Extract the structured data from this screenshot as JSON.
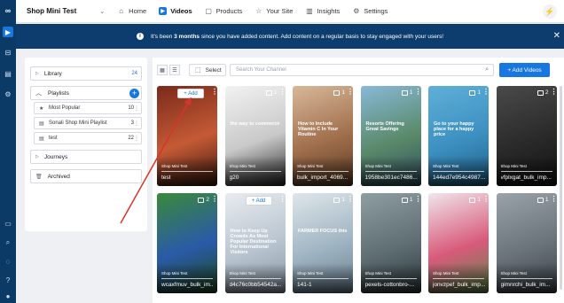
{
  "app": {
    "shop_name": "Shop Mini Test"
  },
  "nav": [
    {
      "label": "Home",
      "icon": "home-icon",
      "glyph": "⌂",
      "active": false
    },
    {
      "label": "Videos",
      "icon": "play-icon",
      "glyph": "▶",
      "active": true
    },
    {
      "label": "Products",
      "icon": "bag-icon",
      "glyph": "▢",
      "active": false
    },
    {
      "label": "Your Site",
      "icon": "star-icon",
      "glyph": "☆",
      "active": false
    },
    {
      "label": "Insights",
      "icon": "chart-icon",
      "glyph": "▥",
      "active": false
    },
    {
      "label": "Settings",
      "icon": "gear-icon",
      "glyph": "⚙",
      "active": false
    }
  ],
  "banner": {
    "prefix": "It's been ",
    "bold": "3 months",
    "suffix": " since you have added content. Add content on a regular basis to stay engaged with your users!"
  },
  "library": {
    "library_label": "Library",
    "library_count": "24",
    "playlists_label": "Playlists",
    "playlists": [
      {
        "name": "Most Popular",
        "count": "10",
        "icon": "star-icon",
        "glyph": "★"
      },
      {
        "name": "Sonali Shop Mini Playlist",
        "count": "3",
        "icon": "list-icon",
        "glyph": "▤"
      },
      {
        "name": "test",
        "count": "22",
        "icon": "list-icon",
        "glyph": "▤"
      }
    ],
    "journeys_label": "Journeys",
    "archived_label": "Archived"
  },
  "toolbar": {
    "select_label": "Select",
    "search_placeholder": "Search Your Channel",
    "add_videos_label": "+ Add Videos",
    "add_label": "+ Add"
  },
  "videos": [
    {
      "title": "test",
      "count": "",
      "brand": "Shop Mini Test",
      "colors": [
        "#7a2a1a",
        "#c55a35",
        "#3b1a10"
      ],
      "add_button": true,
      "overlay": ""
    },
    {
      "title": "g20",
      "count": "1",
      "brand": "Shop Mini Test",
      "colors": [
        "#f2f2f2",
        "#c9c9c9",
        "#2b2b2b"
      ],
      "add_button": false,
      "overlay": "the way to commerce"
    },
    {
      "title": "bulk_import_4069...",
      "count": "1",
      "brand": "Shop Mini Test",
      "colors": [
        "#d8b89a",
        "#a06f4c",
        "#5a3a24"
      ],
      "add_button": false,
      "overlay": "How to Include Vitamin C In Your Routine"
    },
    {
      "title": "1958be301ec7486...",
      "count": "1",
      "brand": "Shop Mini Test",
      "colors": [
        "#88b9d9",
        "#5a8a6a",
        "#2f4f5f"
      ],
      "add_button": false,
      "overlay": "Resorts Offering Great Savings"
    },
    {
      "title": "144ed7e954c4987...",
      "count": "1",
      "brand": "Shop Mini Test",
      "colors": [
        "#5fb0d8",
        "#3c8fc0",
        "#1e5e86"
      ],
      "add_button": false,
      "overlay": "Go to your happy place for a happy price"
    },
    {
      "title": "vfplxgat_bulk_imp...",
      "count": "2",
      "brand": "Shop Mini Test",
      "colors": [
        "#4a4a4a",
        "#2a2a2a",
        "#111111"
      ],
      "add_button": false,
      "overlay": ""
    },
    {
      "title": "wcaxfmuv_bulk_im...",
      "count": "2",
      "brand": "Shop Mini Test",
      "colors": [
        "#3a8a3a",
        "#2a5aa8",
        "#1e4a1e"
      ],
      "add_button": false,
      "overlay": ""
    },
    {
      "title": "d4c76c0bb54542a...",
      "count": "",
      "brand": "Shop Mini Test",
      "colors": [
        "#e8ecf0",
        "#b8c4cf",
        "#8a98a6"
      ],
      "add_button": true,
      "overlay": "How to Keep Up Crowds As Most Popular Destination For International Visitors"
    },
    {
      "title": "141-1",
      "count": "1",
      "brand": "Shop Mini Test",
      "colors": [
        "#dfe6ea",
        "#9fb4c2",
        "#6a8090"
      ],
      "add_button": false,
      "overlay": "FARMER FOCUS this"
    },
    {
      "title": "pexels-cottonbro-...",
      "count": "1",
      "brand": "Shop Mini Test",
      "colors": [
        "#8e9ea2",
        "#5e6e72",
        "#2e3a3e"
      ],
      "add_button": false,
      "overlay": ""
    },
    {
      "title": "jonvzpef_bulk_imp...",
      "count": "1",
      "brand": "Shop Mini Test",
      "colors": [
        "#f0e6ec",
        "#d85a7a",
        "#5a8a4a"
      ],
      "add_button": false,
      "overlay": ""
    },
    {
      "title": "gimnrchi_bulk_im...",
      "count": "1",
      "brand": "Shop Mini Test",
      "colors": [
        "#9aa2aa",
        "#6a727a",
        "#3a4248"
      ],
      "add_button": false,
      "overlay": ""
    }
  ],
  "theme": {
    "accent": "#1777e0",
    "rail": "#0b3a66",
    "banner": "#0d3c6e",
    "annotation_arrow": "#d9342b"
  }
}
